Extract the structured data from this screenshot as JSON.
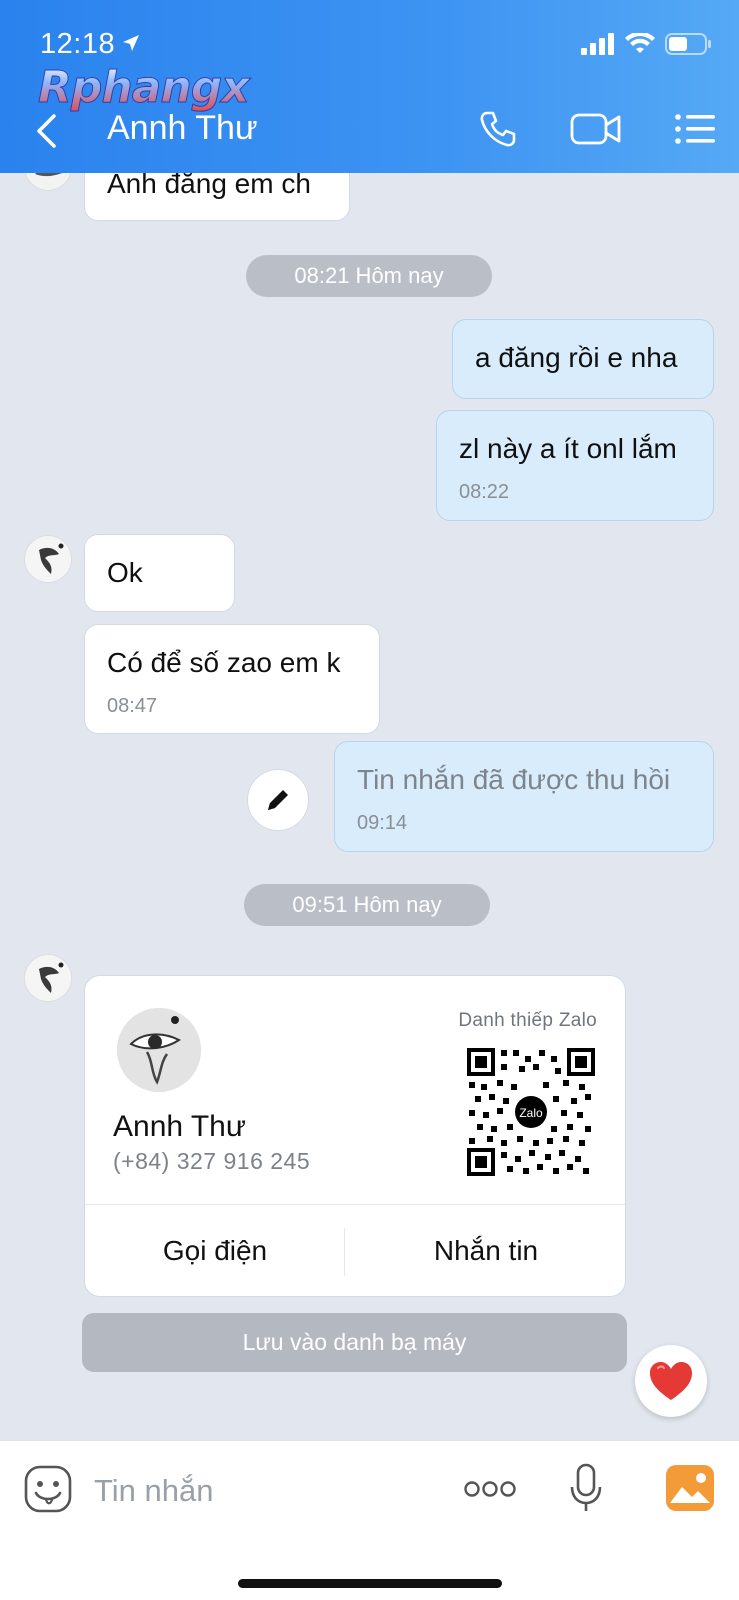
{
  "status_bar": {
    "time": "12:18"
  },
  "watermark": "Rphangx",
  "header": {
    "contact_name": "Annh Thư"
  },
  "messages": {
    "m1_text": "Anh đăng em ch",
    "pill1": "08:21 Hôm nay",
    "m2_text": "a đăng rồi e nha",
    "m3_text": "zl này a ít onl lắm",
    "m3_time": "08:22",
    "m4_text": "Ok",
    "m5_text": "Có để số zao em k",
    "m5_time": "08:47",
    "m6_text": "Tin nhắn đã được thu hồi",
    "m6_time": "09:14",
    "pill2": "09:51 Hôm nay"
  },
  "card": {
    "label": "Danh thiếp Zalo",
    "name": "Annh Thư",
    "phone": "(+84) 327 916 245",
    "qr_badge": "Zalo",
    "call_label": "Gọi điện",
    "message_label": "Nhắn tin",
    "save_label": "Lưu vào danh bạ máy"
  },
  "input": {
    "placeholder": "Tin nhắn"
  },
  "colors": {
    "header_blue": "#2a82ee",
    "out_bubble": "#d8ecfb",
    "chat_bg": "#e2e7ef",
    "heart": "#e53935"
  }
}
